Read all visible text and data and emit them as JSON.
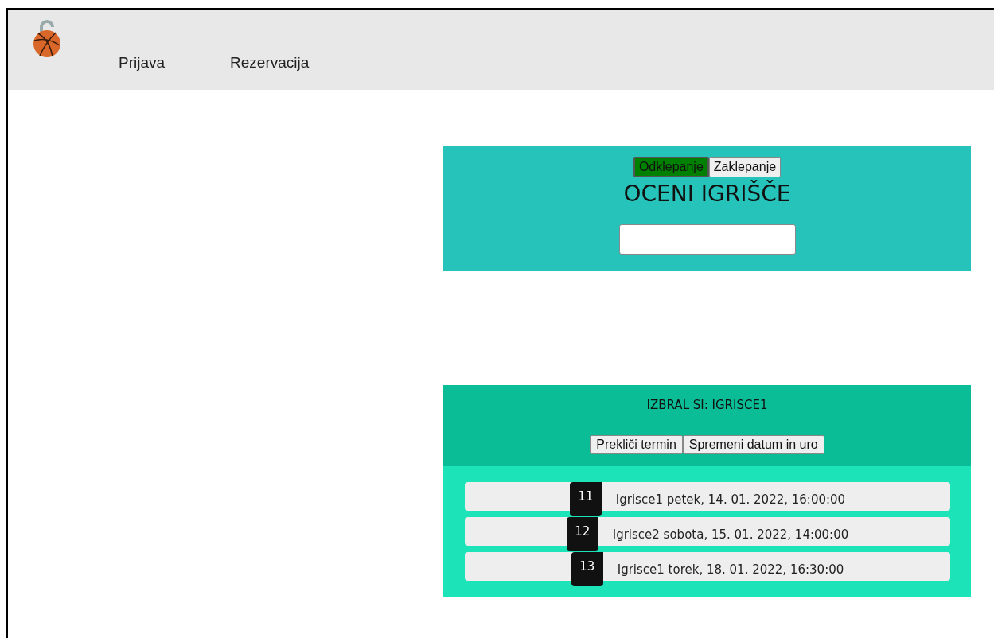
{
  "nav": {
    "items": [
      {
        "label": "Prijava"
      },
      {
        "label": "Rezervacija"
      }
    ]
  },
  "rating": {
    "modes": [
      {
        "label": "Odklepanje",
        "selected": true
      },
      {
        "label": "Zaklepanje",
        "selected": false
      }
    ],
    "title": "OCENI IGRIŠČE"
  },
  "booking": {
    "heading": "IZBRAL SI: IGRISCE1",
    "buttons": [
      {
        "label": "Prekliči termin"
      },
      {
        "label": "Spremeni datum in uro"
      }
    ],
    "reservations": [
      {
        "number": "11",
        "text": "Igrisce1 petek, 14. 01. 2022, 16:00:00"
      },
      {
        "number": "12",
        "text": "Igrisce2 sobota, 15. 01. 2022, 14:00:00"
      },
      {
        "number": "13",
        "text": "Igrisce1 torek, 18. 01. 2022, 16:30:00"
      }
    ]
  }
}
